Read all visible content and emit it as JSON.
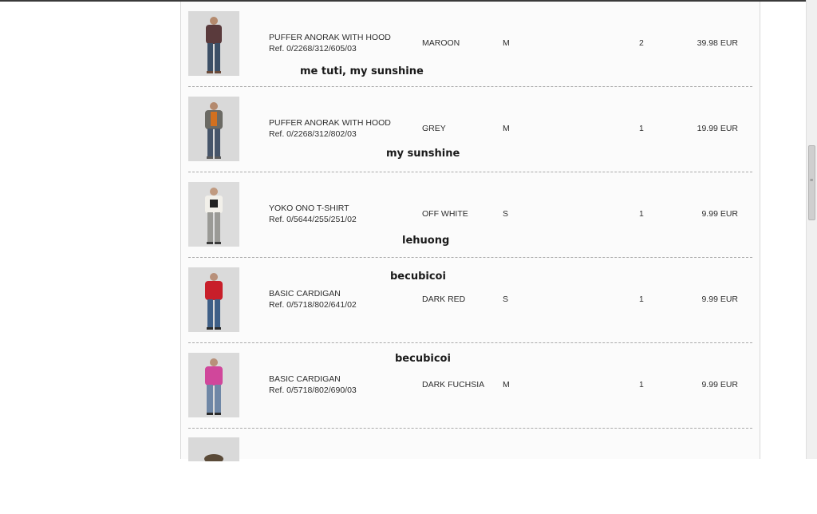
{
  "order_items": [
    {
      "name": "PUFFER ANORAK WITH HOOD",
      "ref": "Ref. 0/2268/312/605/03",
      "color": "MAROON",
      "size": "M",
      "quantity": "2",
      "price": "39.98 EUR",
      "note": "me tuti, my sunshine",
      "garment_color": "#5a3a3c",
      "pants_color": "#3c4f66"
    },
    {
      "name": "PUFFER ANORAK WITH HOOD",
      "ref": "Ref. 0/2268/312/802/03",
      "color": "GREY",
      "size": "M",
      "quantity": "1",
      "price": "19.99 EUR",
      "note": "my sunshine",
      "garment_color": "#6b6a64",
      "pants_color": "#46556a"
    },
    {
      "name": "YOKO ONO T-SHIRT",
      "ref": "Ref. 0/5644/255/251/02",
      "color": "OFF WHITE",
      "size": "S",
      "quantity": "1",
      "price": "9.99 EUR",
      "note": "lehuong",
      "garment_color": "#f2f0ea",
      "pants_color": "#9a9a96"
    },
    {
      "name": "BASIC CARDIGAN",
      "ref": "Ref. 0/5718/802/641/02",
      "color": "DARK RED",
      "size": "S",
      "quantity": "1",
      "price": "9.99 EUR",
      "note": "becubicoi",
      "garment_color": "#c81f2a",
      "pants_color": "#3e5f87"
    },
    {
      "name": "BASIC CARDIGAN",
      "ref": "Ref. 0/5718/802/690/03",
      "color": "DARK FUCHSIA",
      "size": "M",
      "quantity": "1",
      "price": "9.99 EUR",
      "note": "becubicoi",
      "garment_color": "#d0479b",
      "pants_color": "#6f87a6"
    }
  ],
  "icons": {
    "scrollbar_grip": "grip-icon"
  }
}
